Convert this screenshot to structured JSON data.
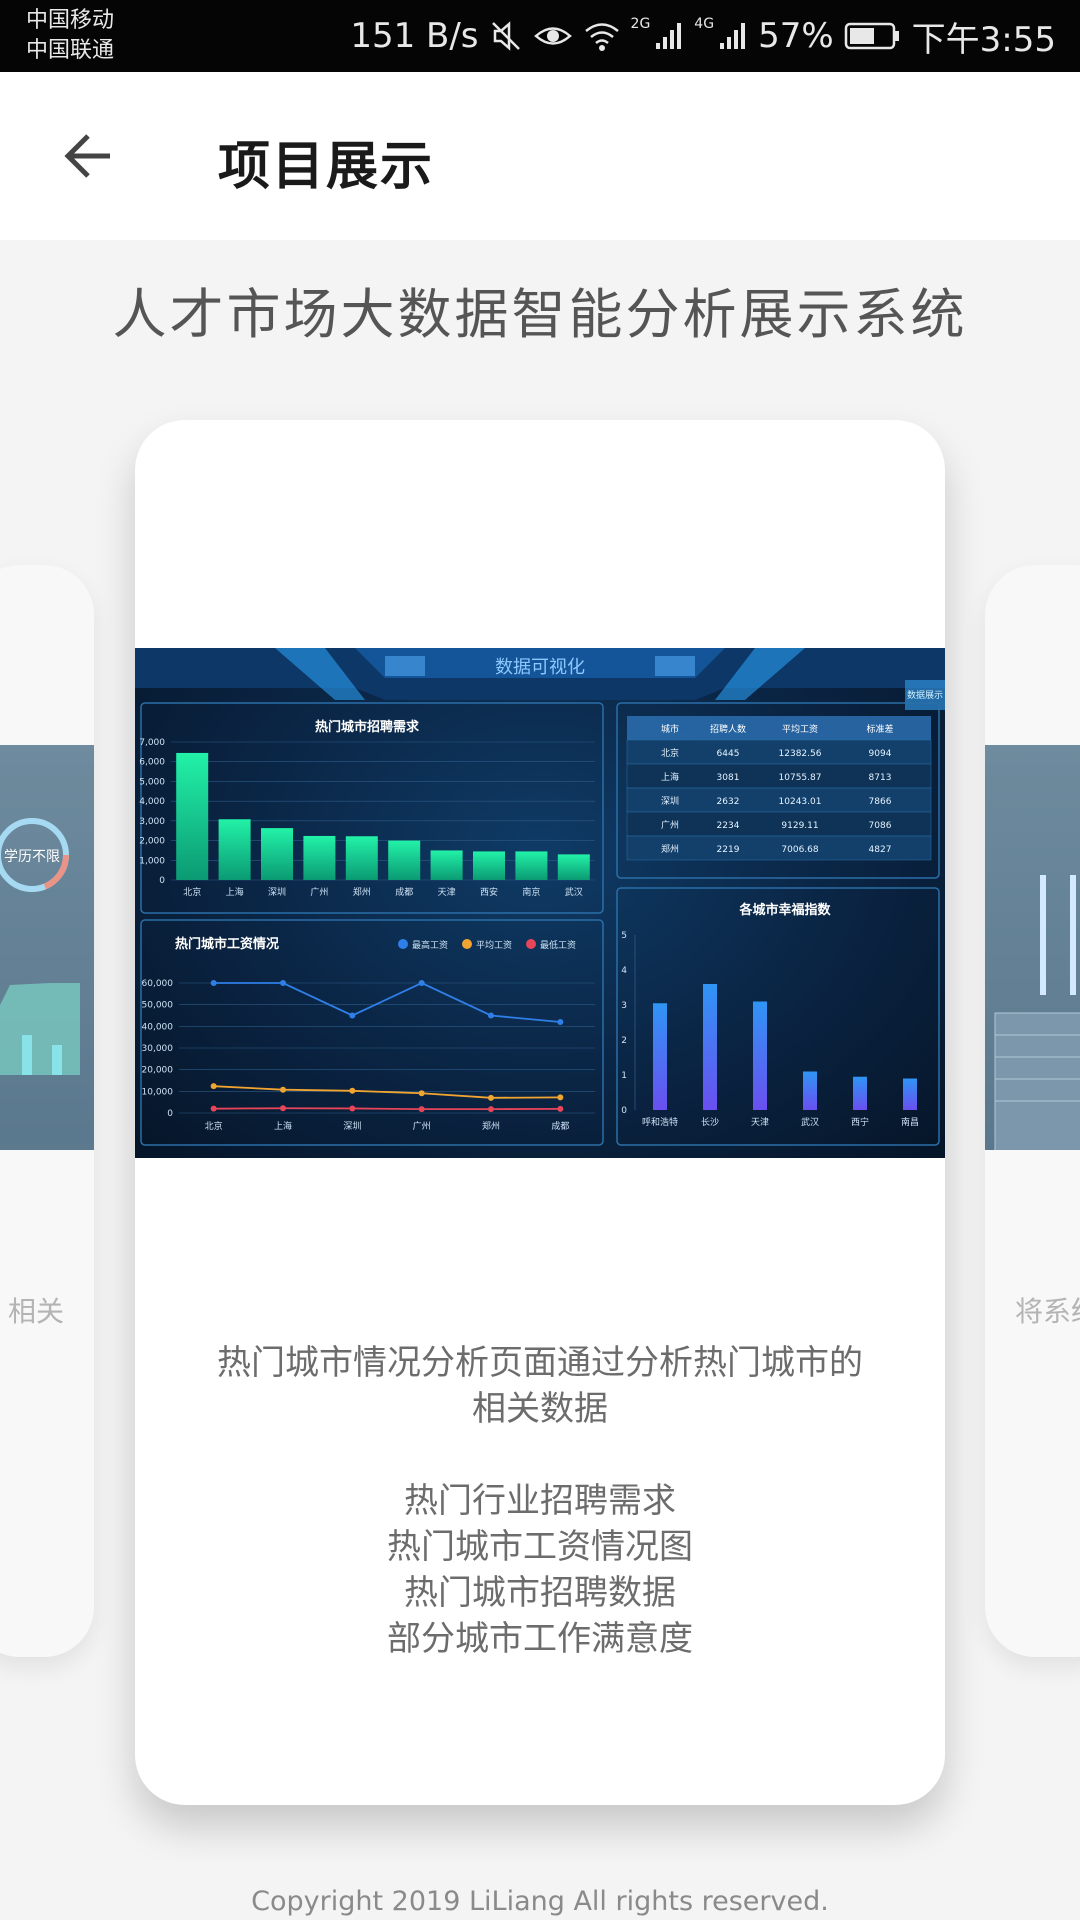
{
  "status_bar": {
    "carrier_1": "中国移动",
    "carrier_2": "中国联通",
    "net_speed": "151 B/s",
    "net_2g": "2G",
    "net_4g": "4G",
    "battery": "57%",
    "time": "下午3:55"
  },
  "app_bar": {
    "title": "项目展示",
    "back_icon": "arrow-left-icon"
  },
  "system_title": "人才市场大数据智能分析展示系统",
  "carousel": {
    "left_card_text": "相关",
    "left_card_chip": "学历不限",
    "right_card_text": "将系统",
    "main_card": {
      "description_lines": [
        "热门城市情况分析页面通过分析热门城市的",
        "相关数据"
      ],
      "feature_lines": [
        "热门行业招聘需求",
        "热门城市工资情况图",
        "热门城市招聘数据",
        "部分城市工作满意度"
      ]
    }
  },
  "dashboard": {
    "title": "数据可视化",
    "corner_button": "数据展示",
    "table": {
      "headers": [
        "城市",
        "招聘人数",
        "平均工资",
        "标准差"
      ],
      "rows": [
        [
          "北京",
          "6445",
          "12382.56",
          "9094"
        ],
        [
          "上海",
          "3081",
          "10755.87",
          "8713"
        ],
        [
          "深圳",
          "2632",
          "10243.01",
          "7866"
        ],
        [
          "广州",
          "2234",
          "9129.11",
          "7086"
        ],
        [
          "郑州",
          "2219",
          "7006.68",
          "4827"
        ]
      ]
    }
  },
  "chart_data": [
    {
      "type": "bar",
      "title": "热门城市招聘需求",
      "categories": [
        "北京",
        "上海",
        "深圳",
        "广州",
        "郑州",
        "成都",
        "天津",
        "西安",
        "南京",
        "武汉"
      ],
      "values": [
        6445,
        3081,
        2632,
        2234,
        2219,
        2000,
        1500,
        1450,
        1450,
        1300
      ],
      "ylim": [
        0,
        7000
      ],
      "yticks": [
        "0",
        "1,000",
        "2,000",
        "3,000",
        "4,000",
        "5,000",
        "6,000",
        "7,000"
      ],
      "color": "#1fe0a0"
    },
    {
      "type": "line",
      "title": "热门城市工资情况",
      "categories": [
        "北京",
        "上海",
        "深圳",
        "广州",
        "郑州",
        "成都"
      ],
      "series": [
        {
          "name": "最高工资",
          "color": "#2f7fe8",
          "values": [
            60000,
            60000,
            45000,
            60000,
            45000,
            42000
          ]
        },
        {
          "name": "平均工资",
          "color": "#f0a531",
          "values": [
            12383,
            10756,
            10243,
            9129,
            7007,
            7200
          ]
        },
        {
          "name": "最低工资",
          "color": "#e6455a",
          "values": [
            2000,
            2200,
            2100,
            1800,
            1800,
            1900
          ]
        }
      ],
      "ylim": [
        0,
        60000
      ],
      "yticks": [
        "0",
        "10,000",
        "20,000",
        "30,000",
        "40,000",
        "50,000",
        "60,000"
      ]
    },
    {
      "type": "bar",
      "title": "各城市幸福指数",
      "categories": [
        "呼和浩特",
        "长沙",
        "天津",
        "武汉",
        "西宁",
        "南昌"
      ],
      "values": [
        3.05,
        3.6,
        3.1,
        1.1,
        0.95,
        0.9
      ],
      "ylim": [
        0,
        5
      ],
      "yticks": [
        "0",
        "1",
        "2",
        "3",
        "4",
        "5"
      ],
      "color": "#5b63f0"
    }
  ],
  "copyright": "Copyright 2019 LiLiang All rights reserved."
}
